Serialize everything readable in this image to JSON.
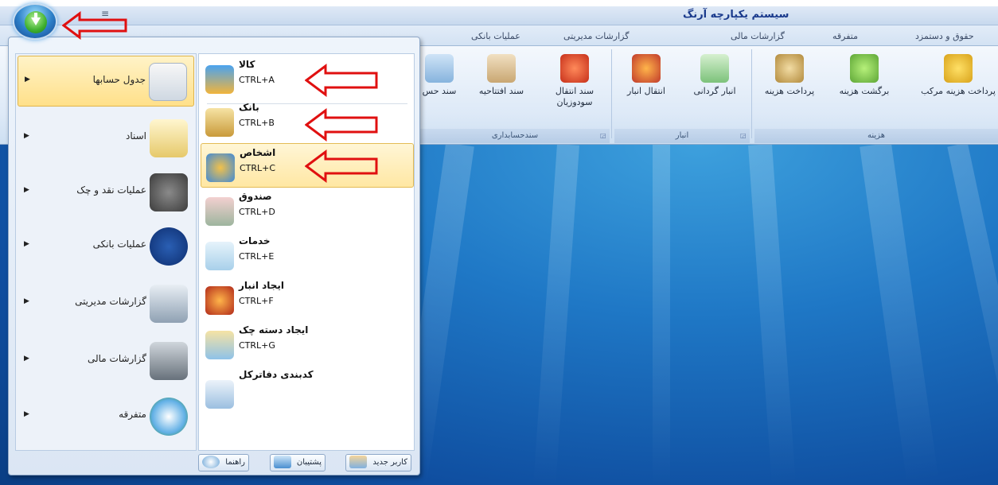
{
  "titlebar": {
    "title": "سیستم یکپارچه آرنگ",
    "qat_icon": "≡"
  },
  "tabs": [
    {
      "label": "حقوق و دستمزد"
    },
    {
      "label": "متفرقه"
    },
    {
      "label": "گزارشات مالی"
    },
    {
      "label": "گزارشات مدیریتی"
    },
    {
      "label": "عملیات بانکی"
    }
  ],
  "ribbon": {
    "buttons": [
      {
        "label": "پرداخت هزینه مرکب",
        "icon": "coins-hand-icon"
      },
      {
        "label": "برگشت هزینه",
        "icon": "money-return-icon"
      },
      {
        "label": "پرداخت هزینه",
        "icon": "money-bag-icon"
      },
      {
        "label": "انبار گردانی",
        "icon": "inventory-sheet-icon"
      },
      {
        "label": "انتقال انبار",
        "icon": "forklift-icon"
      },
      {
        "label": "سند انتقال",
        "label2": "سودوزیان",
        "icon": "car-dollar-icon"
      },
      {
        "label": "سند افتتاحیه",
        "icon": "clipboard-icon"
      },
      {
        "label": "سند حس",
        "icon": "document-icon"
      }
    ],
    "groups": [
      {
        "label": "هزینه"
      },
      {
        "label": "انبار"
      },
      {
        "label": "سندحسابداری"
      }
    ]
  },
  "menu": {
    "left_items": [
      {
        "label": "جدول حسابها",
        "icon": "calendar-table-icon"
      },
      {
        "label": "اسناد",
        "icon": "notepad-icon"
      },
      {
        "label": "عملیات نقد و چک",
        "icon": "calculator-icon"
      },
      {
        "label": "عملیات بانکی",
        "icon": "home-icon"
      },
      {
        "label": "گزارشات مدیریتی",
        "icon": "printer-icon"
      },
      {
        "label": "گزارشات مالی",
        "icon": "calculator-grid-icon"
      },
      {
        "label": "متفرقه",
        "icon": "clock-dollar-icon"
      }
    ],
    "right_items": [
      {
        "title": "کالا",
        "shortcut": "CTRL+A",
        "icon": "gift-box-icon"
      },
      {
        "title": "بانک",
        "shortcut": "CTRL+B",
        "icon": "bank-icon"
      },
      {
        "title": "اشخاص",
        "shortcut": "CTRL+C",
        "icon": "people-icon"
      },
      {
        "title": "صندوق",
        "shortcut": "CTRL+D",
        "icon": "cash-register-icon"
      },
      {
        "title": "خدمات",
        "shortcut": "CTRL+E",
        "icon": "service-doc-icon"
      },
      {
        "title": "ایجاد انبار",
        "shortcut": "CTRL+F",
        "icon": "warehouse-forklift-icon"
      },
      {
        "title": "ایجاد دسته چک",
        "shortcut": "CTRL+G",
        "icon": "checkbook-bank-icon"
      },
      {
        "title": "کدبندی دفاترکل",
        "shortcut": "",
        "icon": "notebook-pen-icon"
      }
    ],
    "bottom_buttons": [
      {
        "label": "کاربر جدید",
        "icon": "new-user-icon"
      },
      {
        "label": "پشتیبان",
        "icon": "backup-icon"
      },
      {
        "label": "راهنما",
        "icon": "help-icon"
      }
    ]
  },
  "colors": {
    "accent": "#1a3a8c",
    "annotation": "#e01010",
    "selection": "#ffe08a",
    "workspace": "#1f78c6"
  }
}
